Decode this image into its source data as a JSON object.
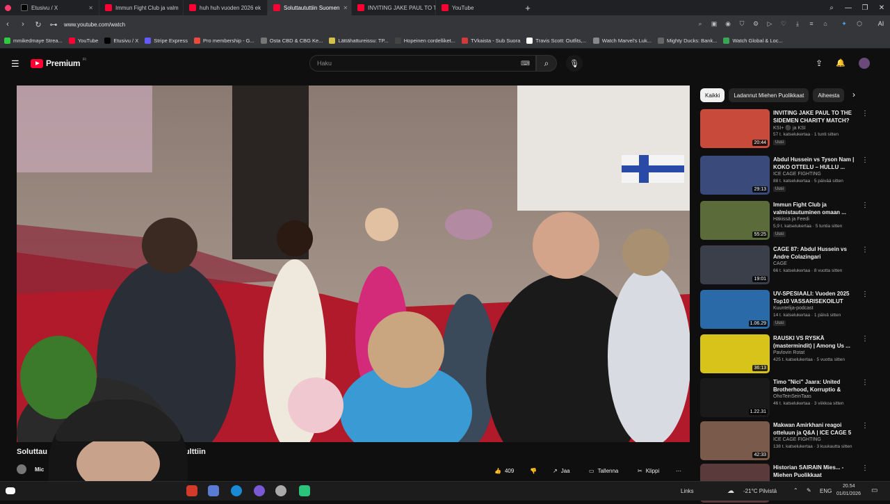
{
  "browser": {
    "tabs": [
      {
        "title": "Etusivu / X",
        "icon": "x-icon",
        "active": false
      },
      {
        "title": "Immun Fight Club ja valm",
        "icon": "youtube-icon",
        "active": false
      },
      {
        "title": "huh huh vuoden 2026 ek",
        "icon": "youtube-icon",
        "active": false
      },
      {
        "title": "Soluttaututtiin Suomen",
        "icon": "youtube-icon",
        "active": true
      },
      {
        "title": "INVITING JAKE PAUL TO T",
        "icon": "youtube-icon",
        "active": false
      },
      {
        "title": "YouTube",
        "icon": "youtube-icon",
        "active": false
      }
    ],
    "new_tab": "+",
    "url": "www.youtube.com/watch",
    "bookmarks": [
      {
        "label": "mmikedmaye Strea...",
        "color": "#2ecc40"
      },
      {
        "label": "YouTube",
        "color": "#ff0033"
      },
      {
        "label": "Etusivu / X",
        "color": "#000000"
      },
      {
        "label": "Stripe Express",
        "color": "#635bff"
      },
      {
        "label": "Pro membership - G...",
        "color": "#e74c3c"
      },
      {
        "label": "Osta CBD & CBG Ke...",
        "color": "#777777"
      },
      {
        "label": "Lättähattureissu: TP...",
        "color": "#d4c04a"
      },
      {
        "label": "Hopeinen cordelliket...",
        "color": "#444444"
      },
      {
        "label": "TVkaista - Sub Suora",
        "color": "#d13a3a"
      },
      {
        "label": "Travis Scott: Outfits,...",
        "color": "#ffffff"
      },
      {
        "label": "Watch Marvel's Luk...",
        "color": "#888888"
      },
      {
        "label": "Mighty Ducks: Bank...",
        "color": "#666666"
      },
      {
        "label": "Watch Global & Loc...",
        "color": "#3aa757"
      }
    ]
  },
  "youtube": {
    "logo_text": "Premium",
    "logo_sup": "FI",
    "search_placeholder": "Haku",
    "chips": [
      "Kaikki",
      "Ladannut Miehen Puolikkaat",
      "Aiheesta"
    ],
    "video_title_left": "Soluttau",
    "video_title_right": "Kulttiin",
    "channel_partial": "Mic",
    "actions": {
      "likes": "409",
      "share": "Jaa",
      "save": "Tallenna",
      "clip": "Klippi"
    }
  },
  "recommendations": [
    {
      "title": "INVITING JAKE PAUL TO THE SIDEMEN CHARITY MATCH?",
      "channel": "KSI+ ⚫ ja KSI",
      "meta": "57 t. katselukertaa · 1 tunti sitten",
      "badge": "Uusi",
      "duration": "20:44",
      "thumb": "#c84a3a"
    },
    {
      "title": "Abdul Hussein vs Tyson Nam | KOKO OTTELU – HULLU ...",
      "channel": "ICE CAGE FIGHTING",
      "meta": "88 t. katselukertaa · 5 päivää sitten",
      "badge": "Uusi",
      "duration": "29:13",
      "thumb": "#3a4a7a"
    },
    {
      "title": "Immun Fight Club ja valmistautuminen omaan ...",
      "channel": "Häkissä ja Feedi",
      "meta": "5,9 t. katselukertaa · 5 tuntia sitten",
      "badge": "Uusi",
      "duration": "55:25",
      "thumb": "#5c6b3a"
    },
    {
      "title": "CAGE 87: Abdul Hussein vs Andre Colazingari",
      "channel": "CAGE",
      "meta": "66 t. katselukertaa · 8 vuotta sitten",
      "badge": "",
      "duration": "19:01",
      "thumb": "#3a3f4a"
    },
    {
      "title": "UV-SPESIAALI: Vuoden 2025 Top10 VASSARISEKOILUT",
      "channel": "Kuuntelija-podcast",
      "meta": "14 t. katselukertaa · 1 päivä sitten",
      "badge": "Uusi",
      "duration": "1.06.29",
      "thumb": "#2a6aa8"
    },
    {
      "title": "RAUSKI VS RYSKÄ (mastermindit) | Among Us ...",
      "channel": "Pavlovin Rotat",
      "meta": "425 t. katselukertaa · 5 vuotta sitten",
      "badge": "",
      "duration": "36:13",
      "thumb": "#d8c31a"
    },
    {
      "title": "Timo \"Nici\" Jaara: United Brotherhood, Korruptio & Usko",
      "channel": "OhoTeinSeinTaas",
      "meta": "46 t. katselukertaa · 3 viikkoa sitten",
      "badge": "",
      "duration": "1.22.31",
      "thumb": "#1a1a1a"
    },
    {
      "title": "Makwan Amirkhani reagoi otteluun ja Q&A | ICE CAGE 5",
      "channel": "ICE CAGE FIGHTING",
      "meta": "138 t. katselukertaa · 3 kuukautta sitten",
      "badge": "",
      "duration": "42:33",
      "thumb": "#7a5a4a"
    },
    {
      "title": "Historian SAIRAIN Mies... - Miehen Puolikkaat",
      "channel": "",
      "meta": "",
      "badge": "",
      "duration": "",
      "thumb": "#5a3a3a"
    }
  ],
  "taskbar": {
    "links": "Links",
    "weather": "-21°C Pilvistä",
    "lang": "ENG",
    "time": "20.54",
    "date": "01/01/2026"
  }
}
